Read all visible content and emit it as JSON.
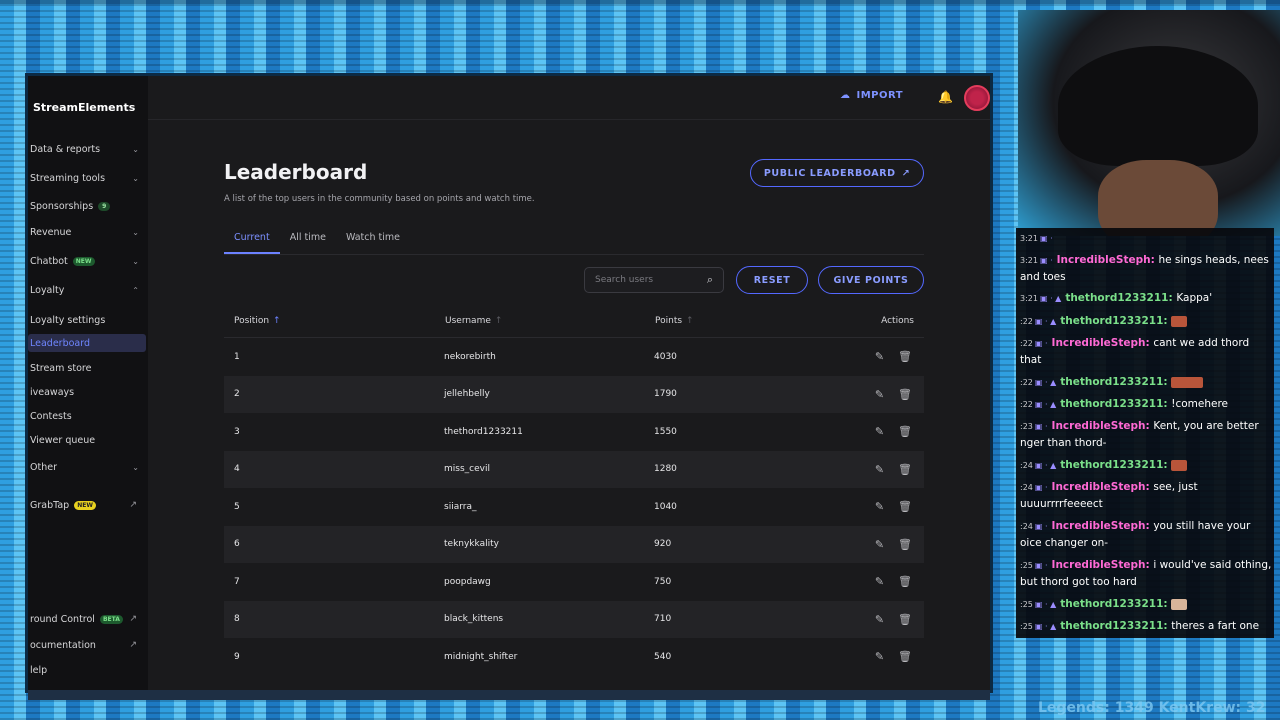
{
  "sidebar": {
    "brand": "StreamElements",
    "items": [
      {
        "label": "Data & reports",
        "chevron": "⌄"
      },
      {
        "label": "Streaming tools",
        "chevron": "⌄"
      },
      {
        "label": "Sponsorships",
        "badge": "9"
      },
      {
        "label": "Revenue",
        "chevron": "⌄"
      },
      {
        "label": "Chatbot",
        "badge": "NEW",
        "chevron": "⌄"
      },
      {
        "label": "Loyalty",
        "chevron": "⌃"
      },
      {
        "label": "Loyalty settings"
      },
      {
        "label": "Leaderboard"
      },
      {
        "label": "Stream store"
      },
      {
        "label": "iveaways"
      },
      {
        "label": "Contests"
      },
      {
        "label": "Viewer queue"
      },
      {
        "label": "Other",
        "chevron": "⌄"
      },
      {
        "label": "GrabTap",
        "badge": "NEW"
      },
      {
        "label": "round Control",
        "badge": "BETA"
      },
      {
        "label": "ocumentation"
      },
      {
        "label": "lelp"
      }
    ]
  },
  "topbar": {
    "import_label": "IMPORT"
  },
  "page": {
    "title": "Leaderboard",
    "subtitle": "A list of the top users in the community based on points and watch time.",
    "public_button": "PUBLIC LEADERBOARD",
    "tabs": [
      "Current",
      "All time",
      "Watch time"
    ],
    "search_placeholder": "Search users",
    "reset_button": "RESET",
    "give_button": "GIVE POINTS"
  },
  "table": {
    "columns": [
      "Position",
      "Username",
      "Points",
      "Actions"
    ],
    "rows": [
      {
        "position": "1",
        "username": "nekorebirth",
        "points": "4030"
      },
      {
        "position": "2",
        "username": "jellehbelly",
        "points": "1790"
      },
      {
        "position": "3",
        "username": "thethord1233211",
        "points": "1550"
      },
      {
        "position": "4",
        "username": "miss_cevil",
        "points": "1280"
      },
      {
        "position": "5",
        "username": "siiarra_",
        "points": "1040"
      },
      {
        "position": "6",
        "username": "teknykkality",
        "points": "920"
      },
      {
        "position": "7",
        "username": "poopdawg",
        "points": "750"
      },
      {
        "position": "8",
        "username": "black_kittens",
        "points": "710"
      },
      {
        "position": "9",
        "username": "midnight_shifter",
        "points": "540"
      }
    ]
  },
  "chat": {
    "lines": [
      {
        "time": "3:21",
        "user": "",
        "msg": ""
      },
      {
        "time": "3:21",
        "user": "IncredibleSteph",
        "color": "pink",
        "msg": "he sings heads, nees and toes"
      },
      {
        "time": "3:21",
        "user": "thethord1233211",
        "color": "green",
        "msg": "Kappa'"
      },
      {
        "time": ":22",
        "user": "thethord1233211",
        "color": "green",
        "msg": "",
        "emote": true
      },
      {
        "time": ":22",
        "user": "IncredibleSteph",
        "color": "pink",
        "msg": "cant we add thord that"
      },
      {
        "time": ":22",
        "user": "thethord1233211",
        "color": "green",
        "msg": "",
        "emote": true
      },
      {
        "time": ":22",
        "user": "thethord1233211",
        "color": "green",
        "msg": "!comehere"
      },
      {
        "time": ":23",
        "user": "IncredibleSteph",
        "color": "pink",
        "msg": "Kent, you are better nger than thord-"
      },
      {
        "time": ":24",
        "user": "thethord1233211",
        "color": "green",
        "msg": "",
        "emote": true
      },
      {
        "time": ":24",
        "user": "IncredibleSteph",
        "color": "pink",
        "msg": "see, just uuuurrrrfeeeect"
      },
      {
        "time": ":24",
        "user": "IncredibleSteph",
        "color": "pink",
        "msg": "you still have your oice changer on-"
      },
      {
        "time": ":25",
        "user": "IncredibleSteph",
        "color": "pink",
        "msg": "i would've said othing, but thord got too hard"
      },
      {
        "time": ":25",
        "user": "thethord1233211",
        "color": "green",
        "msg": "",
        "emote": true
      },
      {
        "time": ":25",
        "user": "thethord1233211",
        "color": "green",
        "msg": "theres a fart one"
      }
    ]
  },
  "footer": {
    "text": "Legends: 1349 KentKrew: 32"
  },
  "colors": {
    "accent": "#6c82ff",
    "bg": "#1a1a1c",
    "sidebar": "#111113",
    "pink": "#ff6ad5",
    "green": "#7be08a"
  },
  "icons": [
    "cloud-upload-icon",
    "bell-icon",
    "avatar",
    "external-link-icon",
    "search-icon",
    "sort-up-icon",
    "edit-icon",
    "trash-icon",
    "chevron-down-icon",
    "chevron-up-icon"
  ]
}
